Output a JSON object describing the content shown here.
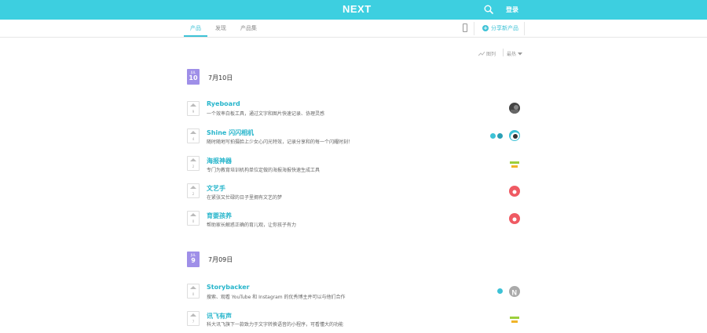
{
  "header": {
    "logo": "NEXT",
    "login": "登录"
  },
  "subnav": {
    "tabs": [
      {
        "label": "产品",
        "active": true
      },
      {
        "label": "发现",
        "active": false
      },
      {
        "label": "产品集",
        "active": false
      }
    ],
    "share_label": "分享新产品"
  },
  "filters": {
    "view": "图列",
    "sort": "最热"
  },
  "days": [
    {
      "month": "JUL",
      "day": "10",
      "title": "7月10日"
    },
    {
      "month": "JUL",
      "day": "9",
      "title": "7月09日"
    }
  ],
  "products": [
    {
      "name": "Ryeboard",
      "desc": "一个效率白板工具，通过文字和图片快速记录、协理灵感",
      "votes": "9"
    },
    {
      "name": "Shine 闪闪相机",
      "desc": "随时随地写拍摄脸上少女心闪光特效，记录分享和的每一个闪耀时刻！",
      "votes": "4"
    },
    {
      "name": "海报神器",
      "desc": "专门为教育培训机构单位定做的海报海报快速生成工具",
      "votes": "2"
    },
    {
      "name": "文艺手",
      "desc": "在紧张又忙碌的日子里拥有文艺的梦",
      "votes": "2"
    },
    {
      "name": "育婴孩养",
      "desc": "帮助家长解惑正确的育儿观，让你孩子有力",
      "votes": "0"
    },
    {
      "name": "Storybacker",
      "desc": "搜索、观看 YouTube 和 Instagram 的优秀博主并可以与他们合作",
      "votes": "0"
    },
    {
      "name": "讯飞有声",
      "desc": "科大讯飞旗下一款致力于文字转换语音的小程序，可看懂大的功能",
      "votes": "7"
    }
  ],
  "colors": {
    "brand": "#3dcfe0",
    "accent": "#3dc2d6",
    "date_badge": "#9f8fe8"
  }
}
